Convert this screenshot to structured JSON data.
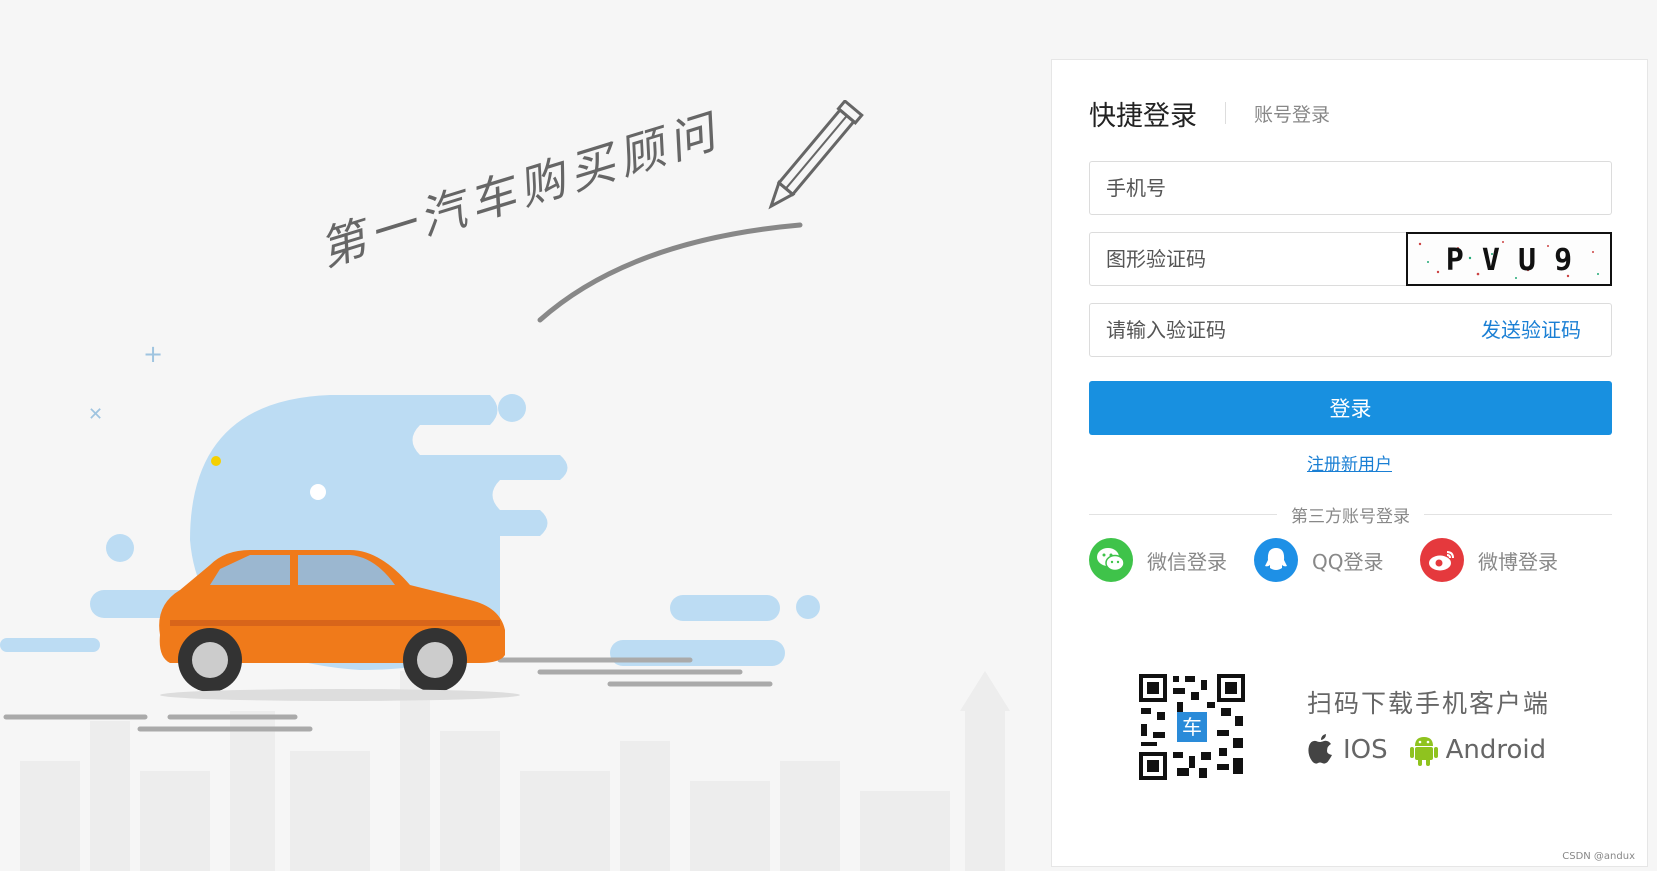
{
  "hero": {
    "slogan": "第一汽车购买顾问"
  },
  "login": {
    "tab_active": "快捷登录",
    "tab_other": "账号登录",
    "phone_placeholder": "手机号",
    "captcha_placeholder": "图形验证码",
    "captcha_text": "P V U 9",
    "sms_placeholder": "请输入验证码",
    "send_code_label": "发送验证码",
    "login_button": "登录",
    "register_link": "注册新用户",
    "third_party_title": "第三方账号登录",
    "social": [
      {
        "label": "微信登录",
        "icon": "wechat-icon",
        "color": "#3fc34a"
      },
      {
        "label": "QQ登录",
        "icon": "qq-icon",
        "color": "#1e90e6"
      },
      {
        "label": "微博登录",
        "icon": "weibo-icon",
        "color": "#e5393d"
      }
    ]
  },
  "download": {
    "title": "扫码下载手机客户端",
    "qr_label": "车",
    "ios_label": "IOS",
    "android_label": "Android"
  },
  "watermark": "CSDN @andux",
  "colors": {
    "primary": "#1890e0",
    "link": "#1a7fd4",
    "car": "#f07a1a",
    "blob": "#a9d2f0"
  }
}
